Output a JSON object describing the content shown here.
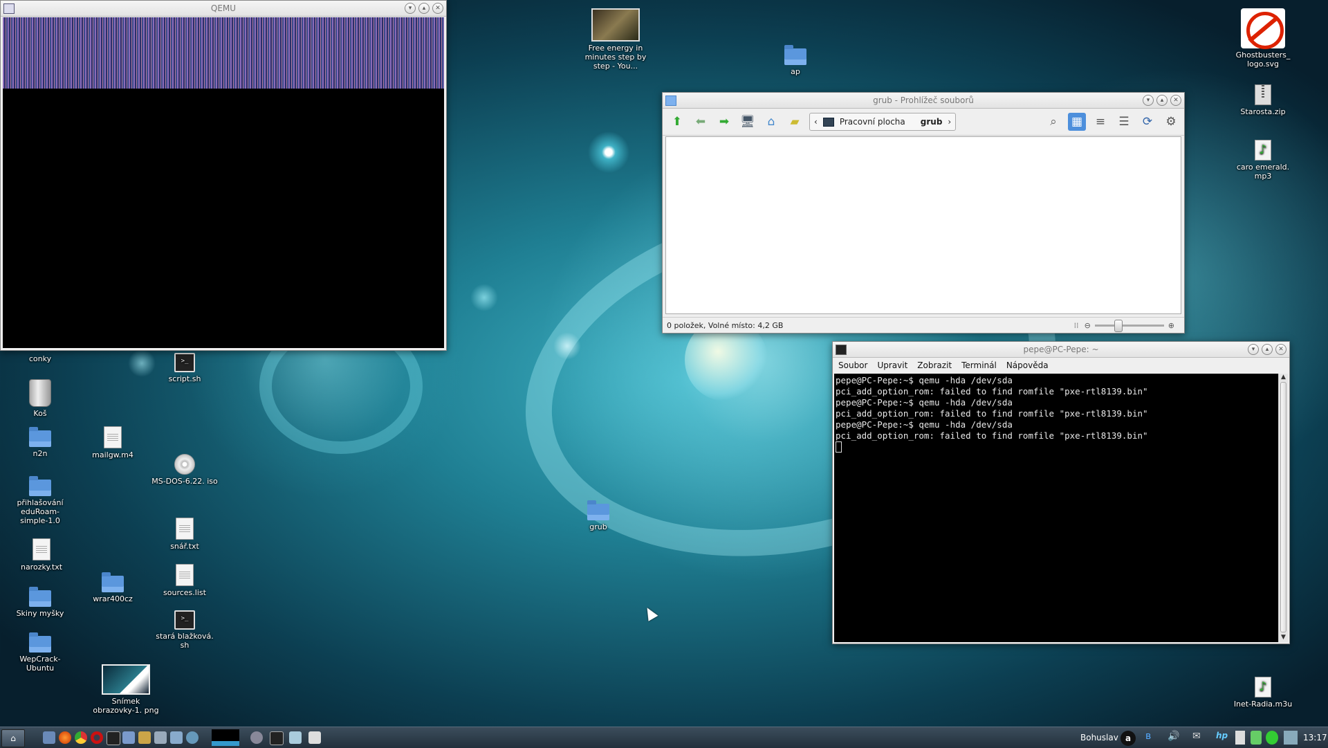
{
  "desktop": {
    "icons": [
      {
        "label": "Free energy in minutes step by step - You...",
        "kind": "video"
      },
      {
        "label": "ap",
        "kind": "folder"
      },
      {
        "label": "Ghostbusters_ logo.svg",
        "kind": "image"
      },
      {
        "label": "Starosta.zip",
        "kind": "zip"
      },
      {
        "label": "caro emerald. mp3",
        "kind": "music"
      },
      {
        "label": "conky",
        "kind": "folder"
      },
      {
        "label": "Koš",
        "kind": "trash"
      },
      {
        "label": "n2n",
        "kind": "folder-locked"
      },
      {
        "label": "přihlašování eduRoam-simple-1.0",
        "kind": "folder"
      },
      {
        "label": "narozky.txt",
        "kind": "text"
      },
      {
        "label": "Skiny myšky",
        "kind": "folder"
      },
      {
        "label": "WepCrack-Ubuntu",
        "kind": "folder"
      },
      {
        "label": "script.sh",
        "kind": "script"
      },
      {
        "label": "mailgw.m4",
        "kind": "file"
      },
      {
        "label": "MS-DOS-6.22. iso",
        "kind": "disc"
      },
      {
        "label": "snář.txt",
        "kind": "text"
      },
      {
        "label": "wrar400cz",
        "kind": "folder"
      },
      {
        "label": "sources.list",
        "kind": "text"
      },
      {
        "label": "stará blažková. sh",
        "kind": "script"
      },
      {
        "label": "Snímek obrazovky-1. png",
        "kind": "screenshot"
      },
      {
        "label": "grub",
        "kind": "folder"
      },
      {
        "label": "Inet-Radia.m3u",
        "kind": "music"
      }
    ]
  },
  "qemu": {
    "title": "QEMU"
  },
  "file_manager": {
    "title": "grub - Prohlížeč souborů",
    "breadcrumb": [
      "Pracovní plocha",
      "grub"
    ],
    "status": "0 položek, Volné místo: 4,2 GB"
  },
  "terminal": {
    "title": "pepe@PC-Pepe: ~",
    "menu": [
      "Soubor",
      "Upravit",
      "Zobrazit",
      "Terminál",
      "Nápověda"
    ],
    "lines": [
      "pepe@PC-Pepe:~$ qemu -hda /dev/sda",
      "pci_add_option_rom: failed to find romfile \"pxe-rtl8139.bin\"",
      "pepe@PC-Pepe:~$ qemu -hda /dev/sda",
      "pci_add_option_rom: failed to find romfile \"pxe-rtl8139.bin\"",
      "pepe@PC-Pepe:~$ qemu -hda /dev/sda",
      "pci_add_option_rom: failed to find romfile \"pxe-rtl8139.bin\""
    ]
  },
  "taskbar": {
    "user": "Bohuslav",
    "clock": "13:17"
  }
}
